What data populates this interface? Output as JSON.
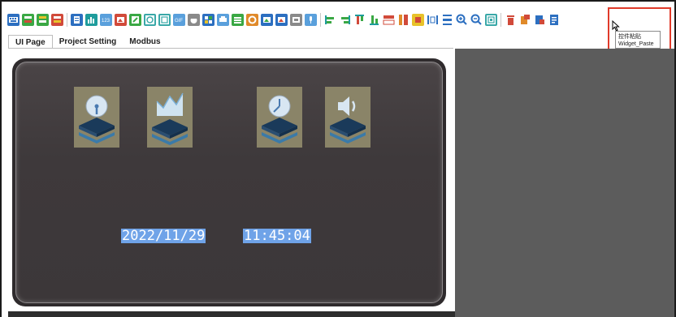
{
  "toolbar": {
    "icons": [
      "keyboard-icon",
      "text-display-icon",
      "numeric-display-icon",
      "register-icon",
      "table-icon",
      "bar-chart-icon",
      "number-pad-icon",
      "image-icon",
      "clock-icon",
      "timer-icon",
      "gif-icon",
      "dial-icon",
      "slider-icon",
      "list-icon",
      "ring-icon",
      "picture-icon",
      "picture-switch-icon",
      "photo-icon",
      "audio-icon",
      "align-left-icon",
      "align-right-icon",
      "align-top-icon",
      "align-bottom-icon",
      "same-height-icon",
      "same-width-icon",
      "same-size-icon",
      "distribute-horizontal-icon",
      "distribute-vertical-icon",
      "zoom-in-icon",
      "zoom-out-icon",
      "fit-icon",
      "delete-icon",
      "widget-copy-icon",
      "widget-cut-icon",
      "widget-paste-icon"
    ]
  },
  "tabs": [
    {
      "label": "UI Page",
      "active": true
    },
    {
      "label": "Project Setting",
      "active": false
    },
    {
      "label": "Modbus",
      "active": false
    }
  ],
  "widgets": [
    {
      "name": "gauge-widget",
      "icon": "gauge-icon"
    },
    {
      "name": "chart-widget",
      "icon": "area-chart-icon"
    },
    {
      "name": "clock-widget",
      "icon": "clock-icon"
    },
    {
      "name": "speaker-widget",
      "icon": "speaker-icon"
    }
  ],
  "datetime": {
    "date": "2022/11/29",
    "time": "11:45:04"
  },
  "tooltip": {
    "line1": "控件粘贴",
    "line2": "Widget_Paste"
  },
  "colors": {
    "panel": "#3e393b",
    "highlight": "#e03a2a",
    "selection": "#6fa3e8",
    "side": "#5c5c5c"
  }
}
